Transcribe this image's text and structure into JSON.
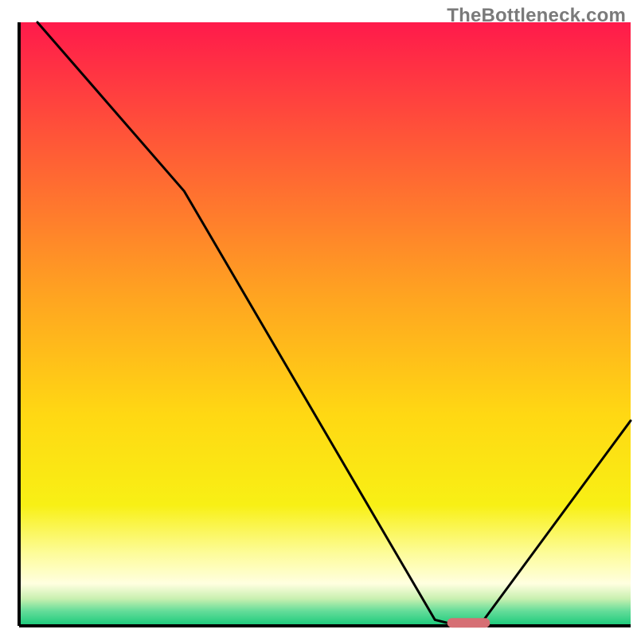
{
  "watermark": "TheBottleneck.com",
  "chart_data": {
    "type": "line",
    "title": "",
    "xlabel": "",
    "ylabel": "",
    "xlim": [
      0,
      100
    ],
    "ylim": [
      0,
      100
    ],
    "grid": false,
    "legend": false,
    "series": [
      {
        "name": "bottleneck-curve",
        "x": [
          3,
          27,
          68,
          72,
          76,
          100
        ],
        "y": [
          100,
          72,
          1,
          0,
          1,
          34
        ]
      }
    ],
    "marker": {
      "name": "optimal-range-marker",
      "x_start": 70,
      "x_end": 77,
      "y": 0.5,
      "color": "#d66f74"
    },
    "background_gradient": {
      "stops": [
        {
          "offset": 0.0,
          "color": "#ff1a4b"
        },
        {
          "offset": 0.2,
          "color": "#ff5837"
        },
        {
          "offset": 0.45,
          "color": "#ffa321"
        },
        {
          "offset": 0.65,
          "color": "#ffd813"
        },
        {
          "offset": 0.8,
          "color": "#f8f015"
        },
        {
          "offset": 0.88,
          "color": "#fdfc9a"
        },
        {
          "offset": 0.93,
          "color": "#ffffe0"
        },
        {
          "offset": 0.955,
          "color": "#c9f0b0"
        },
        {
          "offset": 0.975,
          "color": "#66dd9a"
        },
        {
          "offset": 1.0,
          "color": "#18c97a"
        }
      ]
    },
    "axes": {
      "color": "#000000",
      "width": 4
    }
  }
}
